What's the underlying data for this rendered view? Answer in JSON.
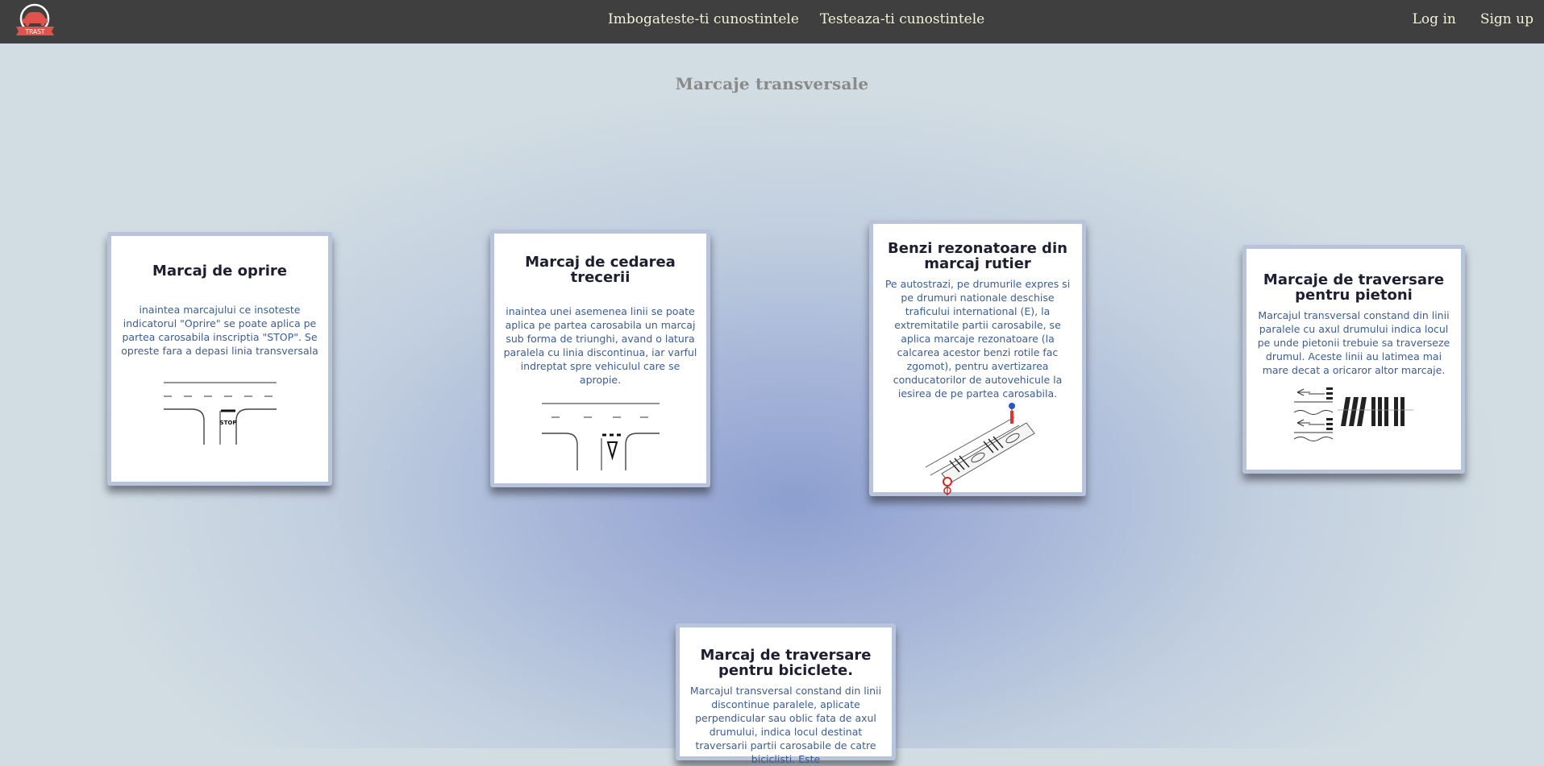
{
  "nav": {
    "logo_text": "TRAST",
    "links": [
      "Imbogateste-ti cunostintele",
      "Testeaza-ti cunostintele"
    ],
    "login": "Log in",
    "signup": "Sign up"
  },
  "page": {
    "title": "Marcaje transversale"
  },
  "cards": [
    {
      "title": "Marcaj de oprire",
      "text": "inaintea marcajului ce insoteste indicatorul \"Oprire\" se poate aplica pe partea carosabila inscriptia \"STOP\". Se opreste fara a depasi linia transversala",
      "illustration_text": "STOP"
    },
    {
      "title": "Marcaj de cedarea trecerii",
      "text": "inaintea unei asemenea linii se poate aplica pe partea carosabila un marcaj sub forma de triunghi, avand o latura paralela cu linia discontinua, iar varful indreptat spre vehiculul care se apropie."
    },
    {
      "title": "Benzi rezonatoare din marcaj rutier",
      "text": "Pe autostrazi, pe drumurile expres si pe drumuri nationale deschise traficului international (E), la extremitatile partii carosabile, se aplica marcaje rezonatoare (la calcarea acestor benzi rotile fac zgomot), pentru avertizarea conducatorilor de autovehicule la iesirea de pe partea carosabila."
    },
    {
      "title": "Marcaje de traversare pentru pietoni",
      "text": "Marcajul transversal constand din linii paralele cu axul drumului indica locul pe unde pietonii trebuie sa traverseze drumul. Aceste linii au latimea mai mare decat a oricaror altor marcaje."
    },
    {
      "title": "Marcaj de traversare pentru biciclete.",
      "text": "Marcajul transversal constand din linii discontinue paralele, aplicate perpendicular sau oblic fata de axul drumului, indica locul destinat traversarii partii carosabile de catre biciclisti. Este"
    }
  ]
}
